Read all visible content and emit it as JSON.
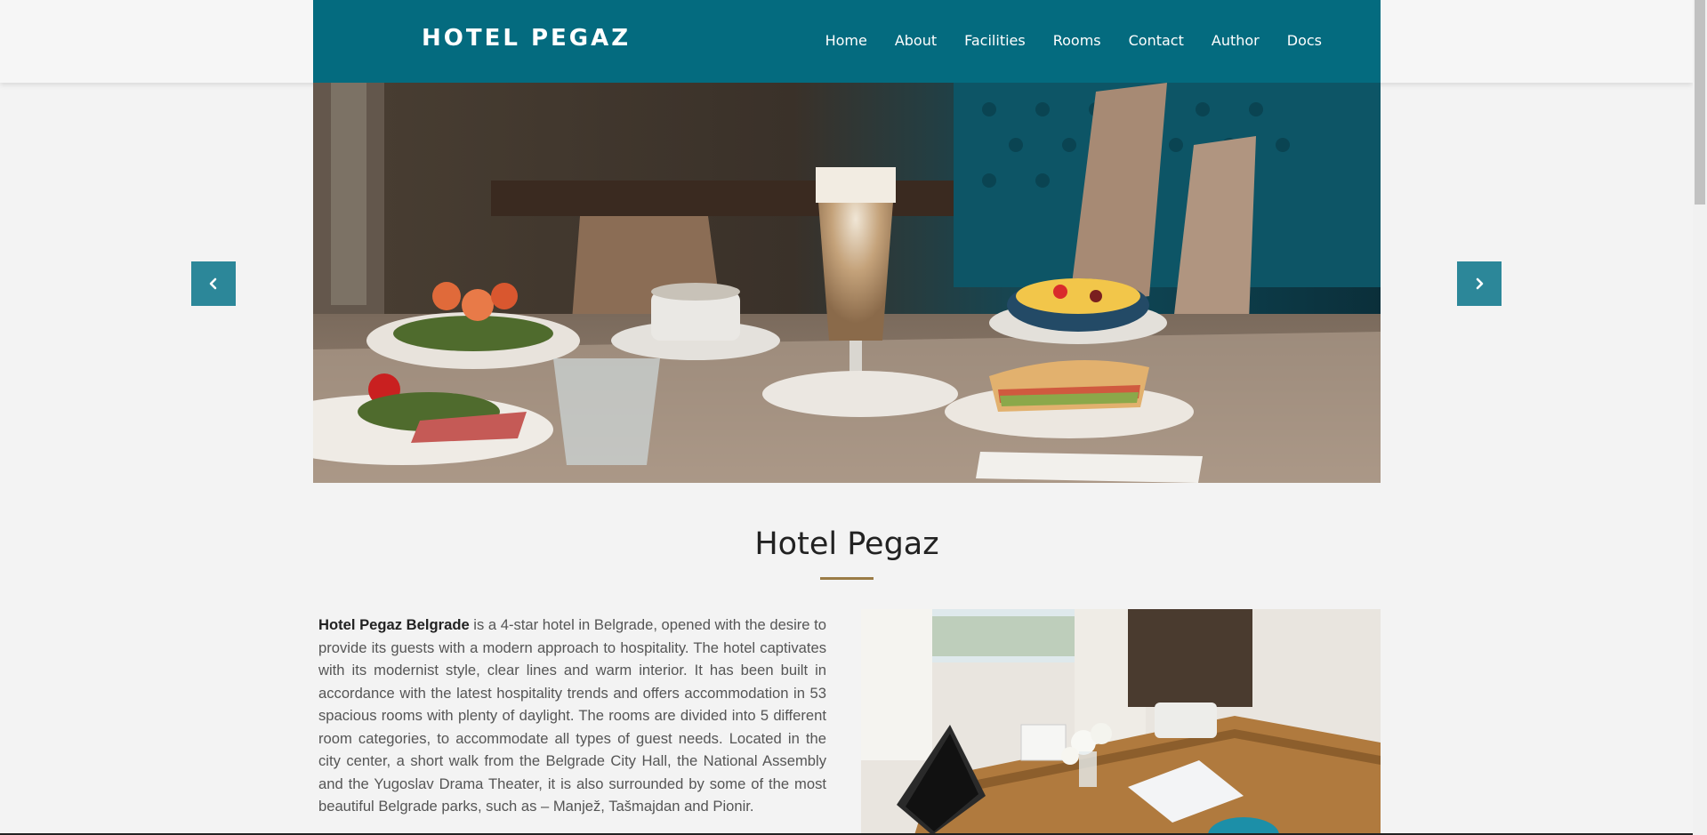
{
  "brand": "HOTEL PEGAZ",
  "nav": [
    "Home",
    "About",
    "Facilities",
    "Rooms",
    "Contact",
    "Author",
    "Docs"
  ],
  "slider": {
    "prev_icon": "chevron-left-icon",
    "next_icon": "chevron-right-icon"
  },
  "section": {
    "title": "Hotel Pegaz",
    "lead_bold": "Hotel Pegaz Belgrade",
    "text": " is a 4-star hotel in Belgrade, opened with the desire to provide its guests with a modern approach to hospitality. The hotel captivates with its modernist style, clear lines and warm interior. It has been built in accordance with the latest hospitality trends and offers accommodation in 53 spacious rooms with plenty of daylight. The rooms are divided into 5 different room categories, to accommodate all types of guest needs. Located in the city center, a short walk from the Belgrade City Hall, the National Assembly and the Yugoslav Drama Theater, it is also surrounded by some of the most beautiful Belgrade parks, such as – Manjež, Tašmajdan and Pionir."
  },
  "colors": {
    "header": "#046b7f",
    "arrow": "#2c8799",
    "underline": "#9a7b46"
  }
}
